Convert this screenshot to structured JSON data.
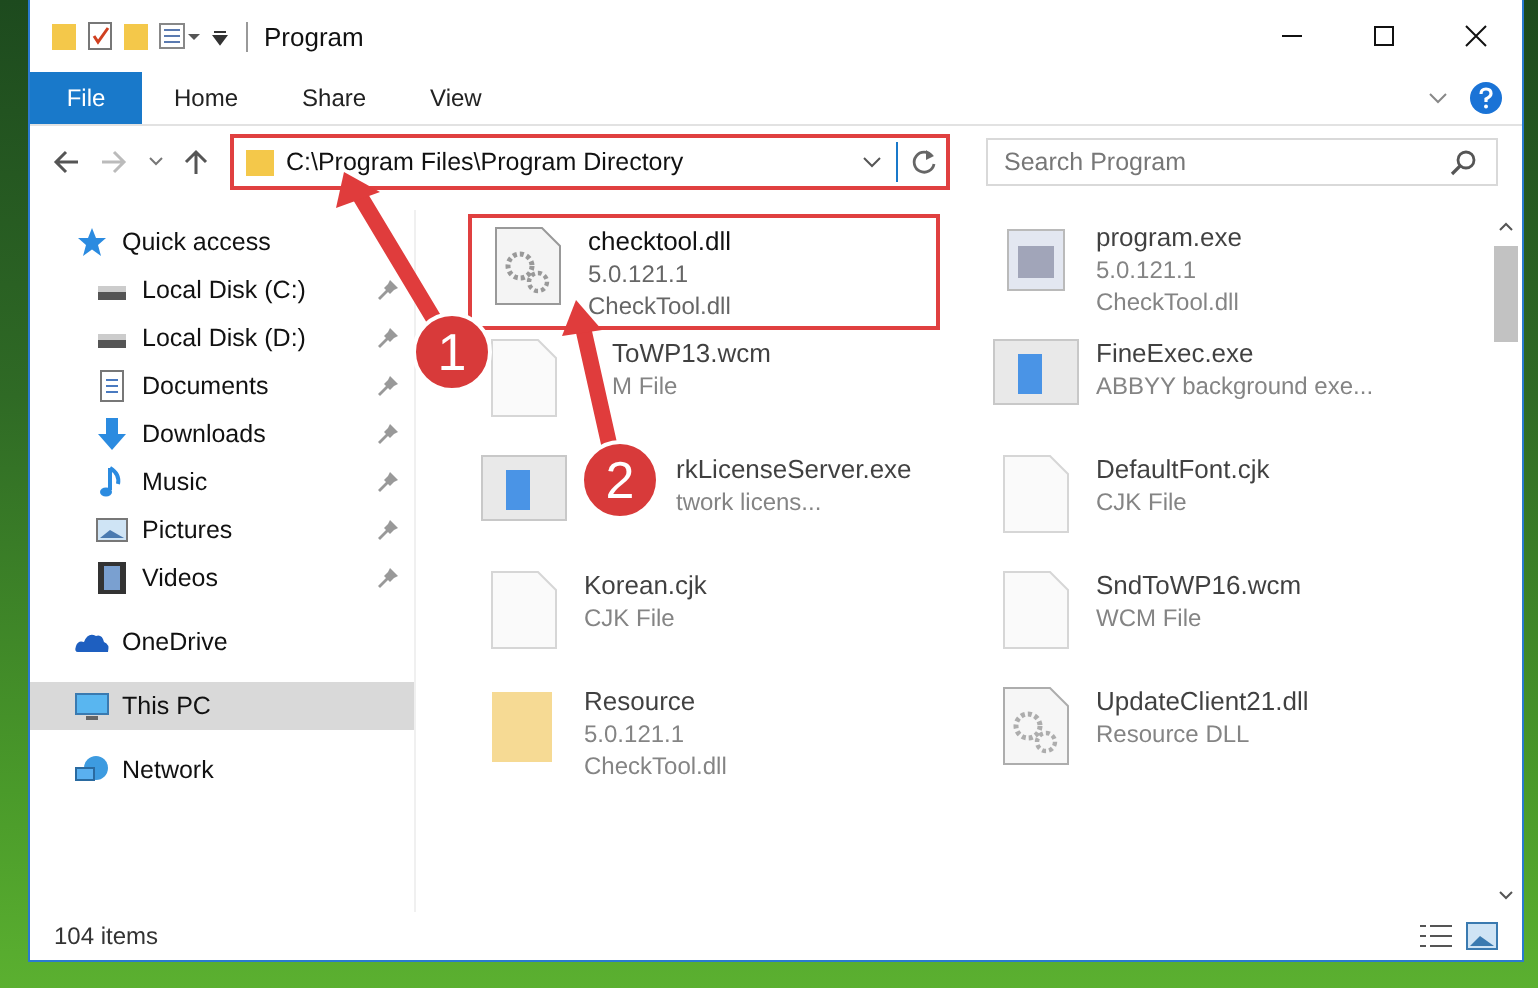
{
  "window": {
    "title": "Program"
  },
  "ribbon_tabs": [
    {
      "label": "File",
      "selected": true
    },
    {
      "label": "Home",
      "selected": false
    },
    {
      "label": "Share",
      "selected": false
    },
    {
      "label": "View",
      "selected": false
    }
  ],
  "address": {
    "value": "C:\\Program Files\\Program Directory",
    "highlighted": true
  },
  "search": {
    "placeholder": "Search Program"
  },
  "sidebar": {
    "items": [
      {
        "label": "Quick access",
        "selected": false,
        "children": [
          {
            "label": "Local Disk (C:)",
            "pinned": true,
            "selected": false
          },
          {
            "label": "Local Disk (D:)",
            "pinned": true,
            "selected": false
          },
          {
            "label": "Documents",
            "pinned": true,
            "selected": false
          },
          {
            "label": "Downloads",
            "pinned": true,
            "selected": false
          },
          {
            "label": "Music",
            "pinned": true,
            "selected": false
          },
          {
            "label": "Pictures",
            "pinned": true,
            "selected": false
          },
          {
            "label": "Videos",
            "pinned": true,
            "selected": false
          }
        ]
      },
      {
        "label": "OneDrive",
        "selected": false
      },
      {
        "label": "This PC",
        "selected": true
      },
      {
        "label": "Network",
        "selected": false
      }
    ]
  },
  "files": [
    {
      "name": "checktool.dll",
      "lines": [
        "5.0.121.1",
        "CheckTool.dll"
      ],
      "highlighted": true
    },
    {
      "name": "program.exe",
      "lines": [
        "5.0.121.1",
        "CheckTool.dll"
      ],
      "highlighted": false
    },
    {
      "name": "ToWP13.wcm",
      "lines": [
        "M File"
      ],
      "highlighted": false
    },
    {
      "name": "FineExec.exe",
      "lines": [
        "ABBYY background exe..."
      ],
      "highlighted": false
    },
    {
      "name": "rkLicenseServer.exe",
      "lines": [
        "twork licens..."
      ],
      "highlighted": false
    },
    {
      "name": "DefaultFont.cjk",
      "lines": [
        "CJK File"
      ],
      "highlighted": false
    },
    {
      "name": "Korean.cjk",
      "lines": [
        "CJK File"
      ],
      "highlighted": false
    },
    {
      "name": "SndToWP16.wcm",
      "lines": [
        "WCM File"
      ],
      "highlighted": false
    },
    {
      "name": "Resource",
      "lines": [
        "5.0.121.1",
        "CheckTool.dll"
      ],
      "highlighted": false
    },
    {
      "name": "UpdateClient21.dll",
      "lines": [
        "Resource DLL"
      ],
      "highlighted": false
    }
  ],
  "status_bar": {
    "item_count": "104 items"
  },
  "annotations": [
    {
      "label": "1"
    },
    {
      "label": "2"
    }
  ]
}
